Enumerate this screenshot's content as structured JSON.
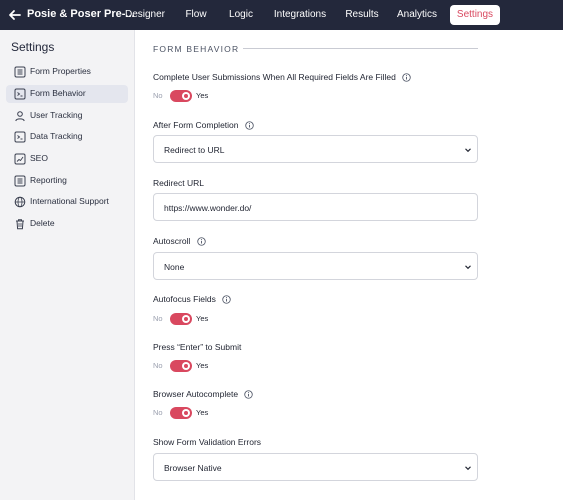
{
  "app": {
    "title": "Posie & Poser Pre-..."
  },
  "nav": {
    "tabs": [
      {
        "label": "Designer",
        "active": false
      },
      {
        "label": "Flow",
        "active": false
      },
      {
        "label": "Logic",
        "active": false
      },
      {
        "label": "Integrations",
        "active": false
      },
      {
        "label": "Results",
        "active": false
      },
      {
        "label": "Analytics",
        "active": false
      },
      {
        "label": "Settings",
        "active": true
      }
    ]
  },
  "sidebar": {
    "title": "Settings",
    "items": [
      {
        "label": "Form Properties",
        "icon": "list-icon",
        "active": false
      },
      {
        "label": "Form Behavior",
        "icon": "terminal-icon",
        "active": true
      },
      {
        "label": "User Tracking",
        "icon": "user-icon",
        "active": false
      },
      {
        "label": "Data Tracking",
        "icon": "terminal-icon",
        "active": false
      },
      {
        "label": "SEO",
        "icon": "chart-icon",
        "active": false
      },
      {
        "label": "Reporting",
        "icon": "list-icon",
        "active": false
      },
      {
        "label": "International Support",
        "icon": "globe-icon",
        "active": false
      },
      {
        "label": "Delete",
        "icon": "trash-icon",
        "active": false
      }
    ]
  },
  "main": {
    "section_heading": "FORM BEHAVIOR",
    "complete_submissions": {
      "label": "Complete User Submissions When All Required Fields Are Filled",
      "no": "No",
      "yes": "Yes",
      "value": true
    },
    "after_completion": {
      "label": "After Form Completion",
      "value": "Redirect to URL"
    },
    "redirect_url": {
      "label": "Redirect URL",
      "value": "https://www.wonder.do/"
    },
    "autoscroll": {
      "label": "Autoscroll",
      "value": "None"
    },
    "autofocus": {
      "label": "Autofocus Fields",
      "no": "No",
      "yes": "Yes",
      "value": true
    },
    "press_enter": {
      "label": "Press “Enter” to Submit",
      "no": "No",
      "yes": "Yes",
      "value": true
    },
    "browser_autocomplete": {
      "label": "Browser Autocomplete",
      "no": "No",
      "yes": "Yes",
      "value": true
    },
    "validation_errors": {
      "label": "Show Form Validation Errors",
      "value": "Browser Native"
    }
  },
  "colors": {
    "accent": "#d9485f",
    "nav_bg": "#23283b",
    "sidebar_bg": "#f3f3f5"
  }
}
